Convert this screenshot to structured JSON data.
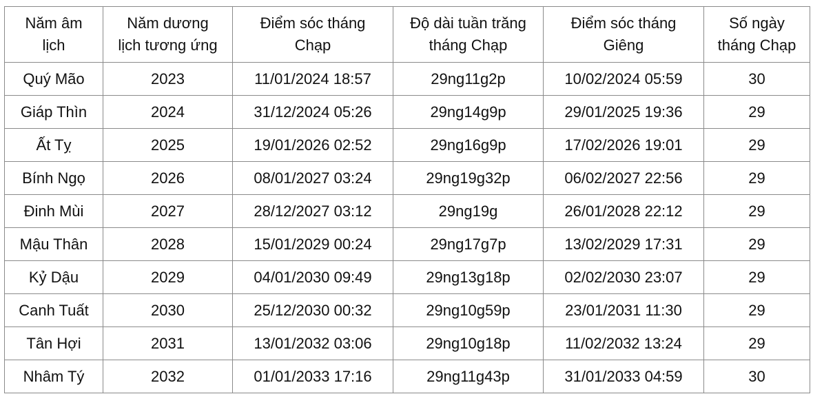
{
  "table": {
    "headers": [
      [
        "Năm âm",
        "lịch"
      ],
      [
        "Năm dương",
        "lịch tương ứng"
      ],
      [
        "Điểm sóc tháng",
        "Chạp"
      ],
      [
        "Độ dài tuần trăng",
        "tháng Chạp"
      ],
      [
        "Điểm sóc tháng",
        "Giêng"
      ],
      [
        "Số ngày",
        "tháng Chạp"
      ]
    ],
    "rows": [
      [
        "Quý Mão",
        "2023",
        "11/01/2024 18:57",
        "29ng11g2p",
        "10/02/2024 05:59",
        "30"
      ],
      [
        "Giáp Thìn",
        "2024",
        "31/12/2024 05:26",
        "29ng14g9p",
        "29/01/2025 19:36",
        "29"
      ],
      [
        "Ất Tỵ",
        "2025",
        "19/01/2026 02:52",
        "29ng16g9p",
        "17/02/2026 19:01",
        "29"
      ],
      [
        "Bính Ngọ",
        "2026",
        "08/01/2027 03:24",
        "29ng19g32p",
        "06/02/2027 22:56",
        "29"
      ],
      [
        "Đinh Mùi",
        "2027",
        "28/12/2027 03:12",
        "29ng19g",
        "26/01/2028 22:12",
        "29"
      ],
      [
        "Mậu Thân",
        "2028",
        "15/01/2029 00:24",
        "29ng17g7p",
        "13/02/2029 17:31",
        "29"
      ],
      [
        "Kỷ Dậu",
        "2029",
        "04/01/2030 09:49",
        "29ng13g18p",
        "02/02/2030 23:07",
        "29"
      ],
      [
        "Canh Tuất",
        "2030",
        "25/12/2030 00:32",
        "29ng10g59p",
        "23/01/2031 11:30",
        "29"
      ],
      [
        "Tân Hợi",
        "2031",
        "13/01/2032 03:06",
        "29ng10g18p",
        "11/02/2032 13:24",
        "29"
      ],
      [
        "Nhâm Tý",
        "2032",
        "01/01/2033 17:16",
        "29ng11g43p",
        "31/01/2033 04:59",
        "30"
      ]
    ]
  }
}
